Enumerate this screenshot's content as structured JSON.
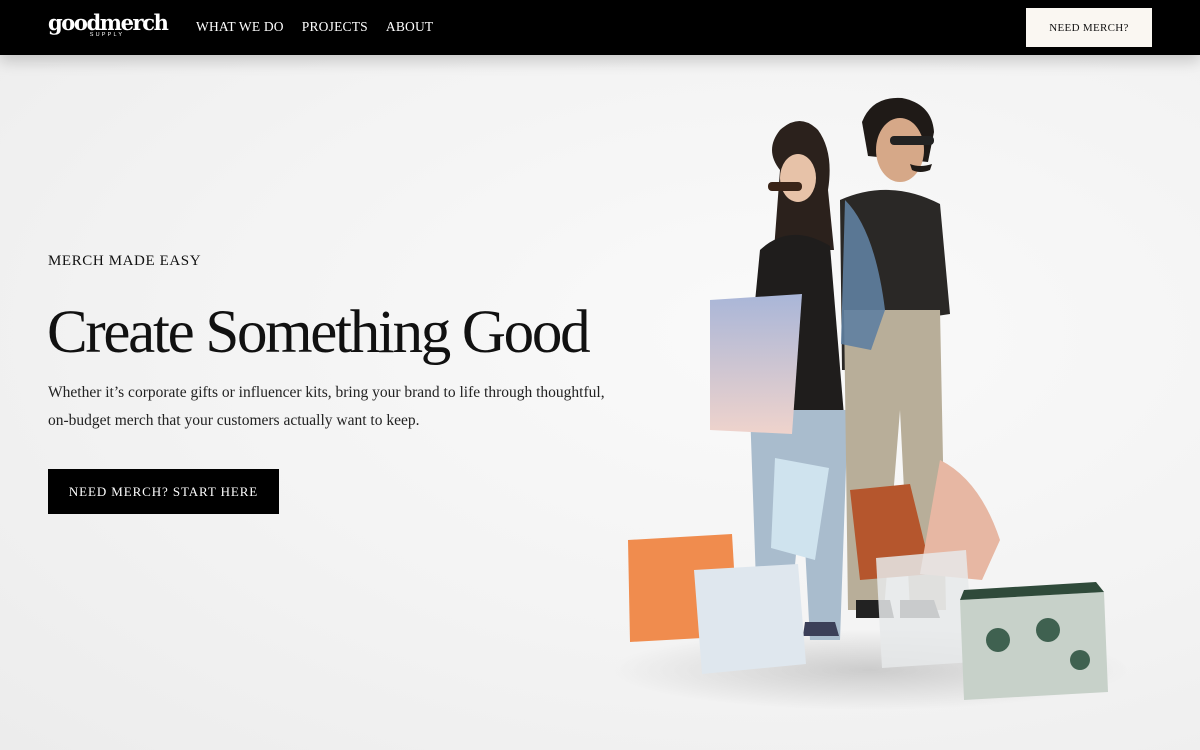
{
  "header": {
    "logo": {
      "word": "goodmerch",
      "sub": "SUPPLY"
    },
    "nav": [
      {
        "label": "WHAT WE DO"
      },
      {
        "label": "PROJECTS"
      },
      {
        "label": "ABOUT"
      }
    ],
    "cta_label": "NEED MERCH?"
  },
  "hero": {
    "eyebrow": "MERCH MADE EASY",
    "headline": "Create Something Good",
    "body": "Whether it’s corporate gifts or influencer kits, bring your brand to life through thoughtful, on-budget merch that your customers actually want to keep.",
    "cta_label": "NEED MERCH? START HERE"
  },
  "colors": {
    "header_bg": "#000000",
    "page_bg": "#f3f3f3",
    "primary_button": "#000000",
    "light_button": "#faf7f2"
  }
}
